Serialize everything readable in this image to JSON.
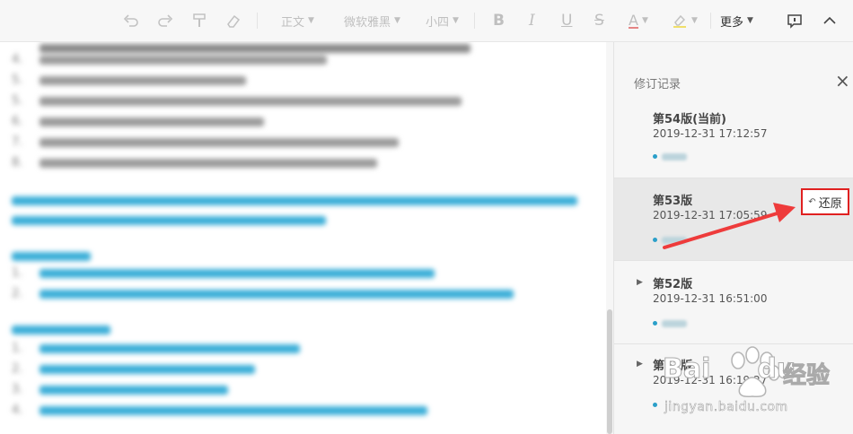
{
  "toolbar": {
    "style_label": "正文",
    "font_label": "微软雅黑",
    "size_label": "小四",
    "more_label": "更多"
  },
  "document": {
    "list_numbers": [
      "4.",
      "5.",
      "5.",
      "6.",
      "7.",
      "8.",
      "1.",
      "2.",
      "1.",
      "2.",
      "3.",
      "4."
    ]
  },
  "panel": {
    "title": "修订记录",
    "close_glyph": "×",
    "versions": [
      {
        "name": "第54版(当前)",
        "date": "2019-12-31 17:12:57"
      },
      {
        "name": "第53版",
        "date": "2019-12-31 17:05:59"
      },
      {
        "name": "第52版",
        "date": "2019-12-31 16:51:00"
      },
      {
        "name": "第51版",
        "date": "2019-12-31 16:19:27"
      }
    ],
    "restore_label": "还原"
  },
  "watermark": {
    "brand": "Bai",
    "brand2": "du",
    "product": "经验",
    "url": "jingyan.baidu.com"
  },
  "colors": {
    "accent_blue": "#2b9fc9",
    "highlight_red": "#e02020",
    "link_text": "#3aaed8"
  }
}
